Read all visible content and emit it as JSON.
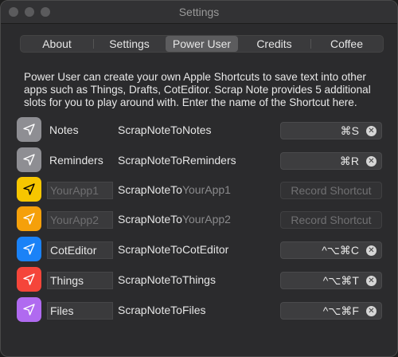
{
  "window": {
    "title": "Settings"
  },
  "tabs": [
    {
      "label": "About"
    },
    {
      "label": "Settings"
    },
    {
      "label": "Power User",
      "active": true
    },
    {
      "label": "Credits"
    },
    {
      "label": "Coffee"
    }
  ],
  "description": "Power User can create your own Apple Shortcuts to save text into other apps such as Things, Drafts, CotEditor. Scrap Note provides 5 additional slots for you to play around with. Enter the name of the Shortcut here.",
  "rows": [
    {
      "icon_color": "#8e8e93",
      "icon": "send-icon",
      "name": "Notes",
      "shortcut_prefix": "ScrapNoteTo",
      "shortcut_suffix": "Notes",
      "keys": "⌘S"
    },
    {
      "icon_color": "#8e8e93",
      "icon": "send-icon",
      "name": "Reminders",
      "shortcut_prefix": "ScrapNoteTo",
      "shortcut_suffix": "Reminders",
      "keys": "⌘R"
    },
    {
      "icon_color": "#f7c600",
      "icon": "send-icon",
      "name_placeholder": "YourApp1",
      "shortcut_prefix": "ScrapNoteTo",
      "shortcut_suffix": "YourApp1",
      "record_label": "Record Shortcut"
    },
    {
      "icon_color": "#f5a00a",
      "icon": "send-icon",
      "name_placeholder": "YourApp2",
      "shortcut_prefix": "ScrapNoteTo",
      "shortcut_suffix": "YourApp2",
      "record_label": "Record Shortcut"
    },
    {
      "icon_color": "#1a82f7",
      "icon": "send-icon",
      "name": "CotEditor",
      "shortcut_prefix": "ScrapNoteTo",
      "shortcut_suffix": "CotEditor",
      "keys": "^⌥⌘C"
    },
    {
      "icon_color": "#f5453a",
      "icon": "send-icon",
      "name": "Things",
      "shortcut_prefix": "ScrapNoteTo",
      "shortcut_suffix": "Things",
      "keys": "^⌥⌘T"
    },
    {
      "icon_color": "#b06af0",
      "icon": "send-icon",
      "name": "Files",
      "shortcut_prefix": "ScrapNoteTo",
      "shortcut_suffix": "Files",
      "keys": "^⌥⌘F"
    }
  ]
}
